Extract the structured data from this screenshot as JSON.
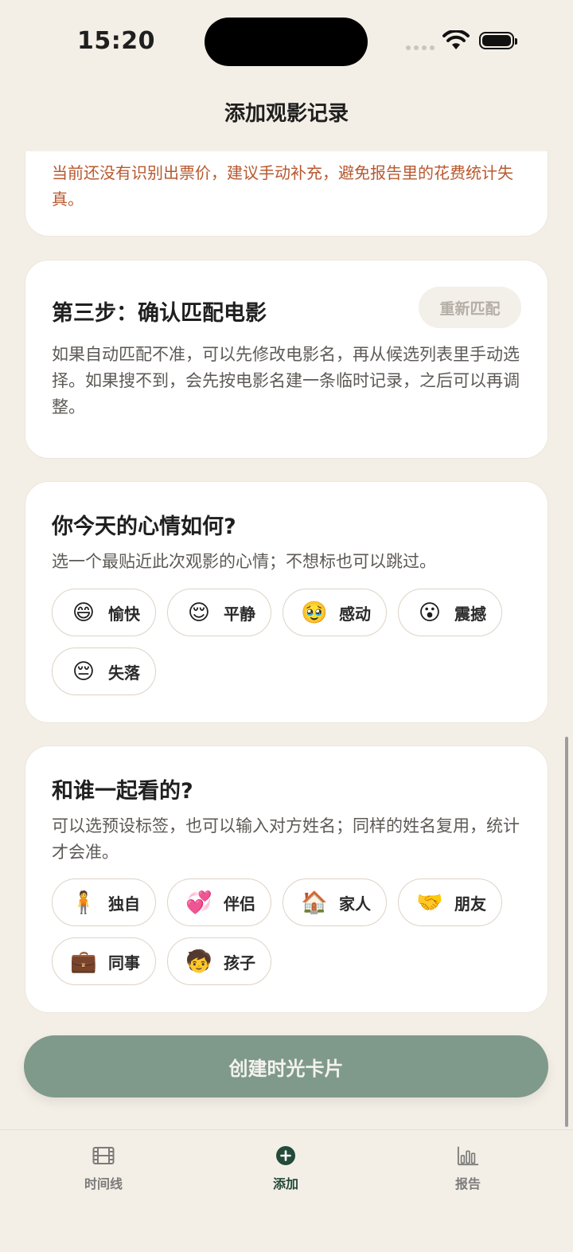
{
  "status_bar": {
    "time": "15:20"
  },
  "nav": {
    "title": "添加观影记录"
  },
  "warning": {
    "text": "当前还没有识别出票价，建议手动补充，避免报告里的花费统计失真。"
  },
  "step_three": {
    "title": "第三步：确认匹配电影",
    "rematch_label": "重新匹配",
    "description": "如果自动匹配不准，可以先修改电影名，再从候选列表里手动选择。如果搜不到，会先按电影名建一条临时记录，之后可以再调整。"
  },
  "mood": {
    "title": "你今天的心情如何?",
    "description": "选一个最贴近此次观影的心情；不想标也可以跳过。",
    "options": [
      {
        "emoji": "😄",
        "label": "愉快"
      },
      {
        "emoji": "😌",
        "label": "平静"
      },
      {
        "emoji": "🥹",
        "label": "感动"
      },
      {
        "emoji": "😮",
        "label": "震撼"
      },
      {
        "emoji": "😔",
        "label": "失落"
      }
    ]
  },
  "companion": {
    "title": "和谁一起看的?",
    "description": "可以选预设标签，也可以输入对方姓名；同样的姓名复用，统计才会准。",
    "options": [
      {
        "emoji": "🧍",
        "label": "独自"
      },
      {
        "emoji": "💞",
        "label": "伴侣"
      },
      {
        "emoji": "🏠",
        "label": "家人"
      },
      {
        "emoji": "🤝",
        "label": "朋友"
      },
      {
        "emoji": "💼",
        "label": "同事"
      },
      {
        "emoji": "🧒",
        "label": "孩子"
      }
    ]
  },
  "cta": {
    "label": "创建时光卡片"
  },
  "tabs": [
    {
      "label": "时间线",
      "icon": "film-icon"
    },
    {
      "label": "添加",
      "icon": "plus-circle-icon"
    },
    {
      "label": "报告",
      "icon": "bar-chart-icon"
    }
  ],
  "colors": {
    "background": "#f4efe6",
    "warning_text": "#b8582f",
    "cta": "#7f9a8a",
    "active_tab": "#244a3a"
  }
}
